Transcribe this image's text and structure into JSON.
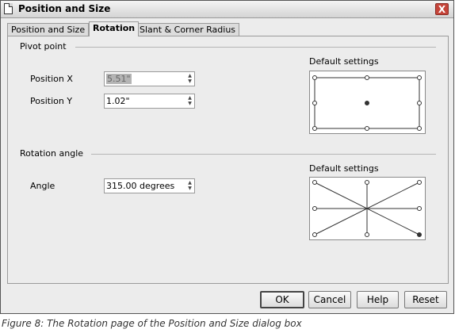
{
  "window": {
    "title": "Position and Size",
    "close_glyph": "X"
  },
  "tabs": [
    {
      "label": "Position and Size"
    },
    {
      "label": "Rotation"
    },
    {
      "label": "Slant & Corner Radius"
    }
  ],
  "pivot": {
    "heading": "Pivot point",
    "pos_x_label": "Position X",
    "pos_x_value": "5.51\"",
    "pos_y_label": "Position Y",
    "pos_y_value": "1.02\"",
    "default_label": "Default settings"
  },
  "rotation": {
    "heading": "Rotation angle",
    "angle_label": "Angle",
    "angle_value": "315.00 degrees",
    "default_label": "Default settings"
  },
  "buttons": {
    "ok": "OK",
    "cancel": "Cancel",
    "help": "Help",
    "reset": "Reset"
  },
  "caption": "Figure 8: The Rotation page of the Position and Size dialog box"
}
